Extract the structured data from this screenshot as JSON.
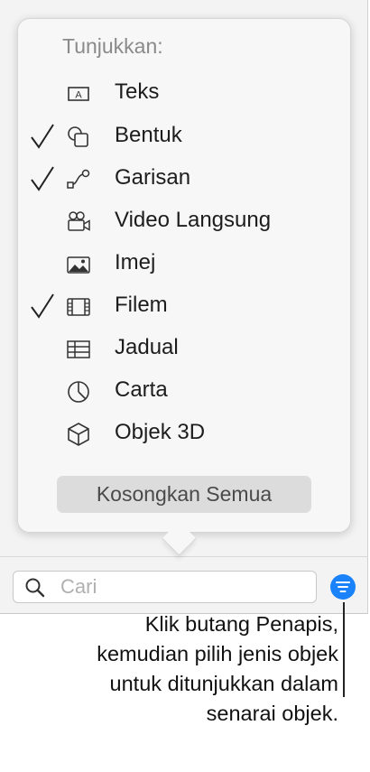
{
  "popover": {
    "heading": "Tunjukkan:",
    "items": [
      {
        "label": "Teks",
        "checked": false,
        "icon": "text-box-icon"
      },
      {
        "label": "Bentuk",
        "checked": true,
        "icon": "shape-icon"
      },
      {
        "label": "Garisan",
        "checked": true,
        "icon": "line-icon"
      },
      {
        "label": "Video Langsung",
        "checked": false,
        "icon": "live-video-icon"
      },
      {
        "label": "Imej",
        "checked": false,
        "icon": "image-icon"
      },
      {
        "label": "Filem",
        "checked": true,
        "icon": "film-icon"
      },
      {
        "label": "Jadual",
        "checked": false,
        "icon": "table-icon"
      },
      {
        "label": "Carta",
        "checked": false,
        "icon": "chart-icon"
      },
      {
        "label": "Objek 3D",
        "checked": false,
        "icon": "cube-icon"
      }
    ],
    "clear_all_label": "Kosongkan Semua"
  },
  "search": {
    "placeholder": "Cari",
    "value": ""
  },
  "colors": {
    "accent": "#1a82fb",
    "panel_background": "#f3f3f3",
    "popover_background": "#f7f7f7"
  },
  "callout": {
    "lines": [
      "Klik butang Penapis,",
      "kemudian pilih jenis objek",
      "untuk ditunjukkan dalam",
      "senarai objek."
    ]
  }
}
